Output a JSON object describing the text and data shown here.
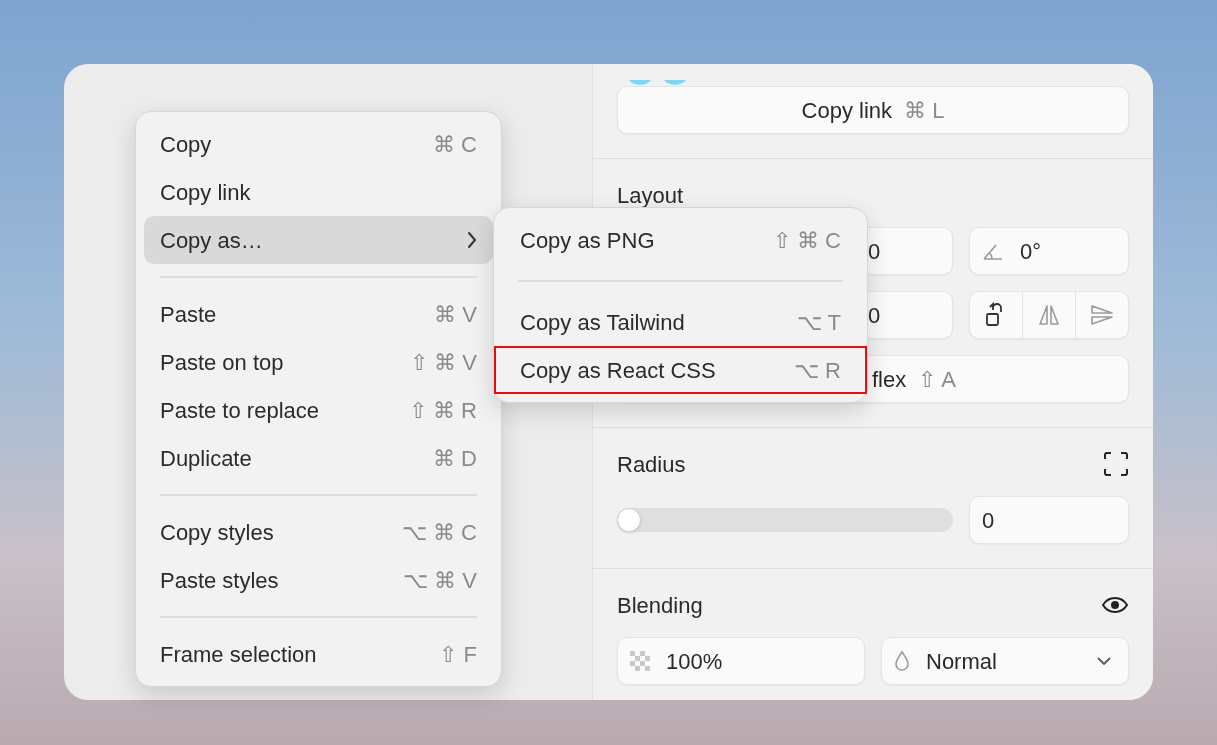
{
  "context_menu": {
    "groups": [
      {
        "items": [
          {
            "label": "Copy",
            "shortcut": "⌘ C",
            "selected": false,
            "has_submenu": false
          },
          {
            "label": "Copy link",
            "selected": false,
            "has_submenu": false
          },
          {
            "label": "Copy as…",
            "selected": true,
            "has_submenu": true
          }
        ]
      },
      {
        "items": [
          {
            "label": "Paste",
            "shortcut": "⌘ V",
            "selected": false,
            "has_submenu": false
          },
          {
            "label": "Paste on top",
            "shortcut": "⇧ ⌘ V",
            "selected": false,
            "has_submenu": false
          },
          {
            "label": "Paste to replace",
            "shortcut": "⇧ ⌘ R",
            "selected": false,
            "has_submenu": false
          },
          {
            "label": "Duplicate",
            "shortcut": "⌘ D",
            "selected": false,
            "has_submenu": false
          }
        ]
      },
      {
        "items": [
          {
            "label": "Copy styles",
            "shortcut": "⌥ ⌘ C",
            "selected": false,
            "has_submenu": false
          },
          {
            "label": "Paste styles",
            "shortcut": "⌥ ⌘ V",
            "selected": false,
            "has_submenu": false
          }
        ]
      },
      {
        "items": [
          {
            "label": "Frame selection",
            "shortcut": "⇧ F",
            "selected": false,
            "has_submenu": false
          }
        ]
      }
    ]
  },
  "submenu": {
    "groups": [
      {
        "items": [
          {
            "label": "Copy as PNG",
            "shortcut": "⇧ ⌘ C",
            "highlighted": false
          }
        ]
      },
      {
        "items": [
          {
            "label": "Copy as Tailwind",
            "shortcut": "⌥ T",
            "highlighted": false
          },
          {
            "label": "Copy as React CSS",
            "shortcut": "⌥ R",
            "highlighted": true
          }
        ]
      }
    ]
  },
  "panel": {
    "copy_link": {
      "label": "Copy link",
      "shortcut": "⌘ L"
    },
    "layout": {
      "title": "Layout",
      "width_value": "0",
      "angle_value": "0°",
      "height_value": "0",
      "flex_button": {
        "label": "flex",
        "shortcut": "⇧ A"
      }
    },
    "radius": {
      "title": "Radius",
      "slider": {
        "level": 0
      },
      "value": "0"
    },
    "blending": {
      "title": "Blending",
      "opacity": "100%",
      "mode": "Normal"
    }
  }
}
